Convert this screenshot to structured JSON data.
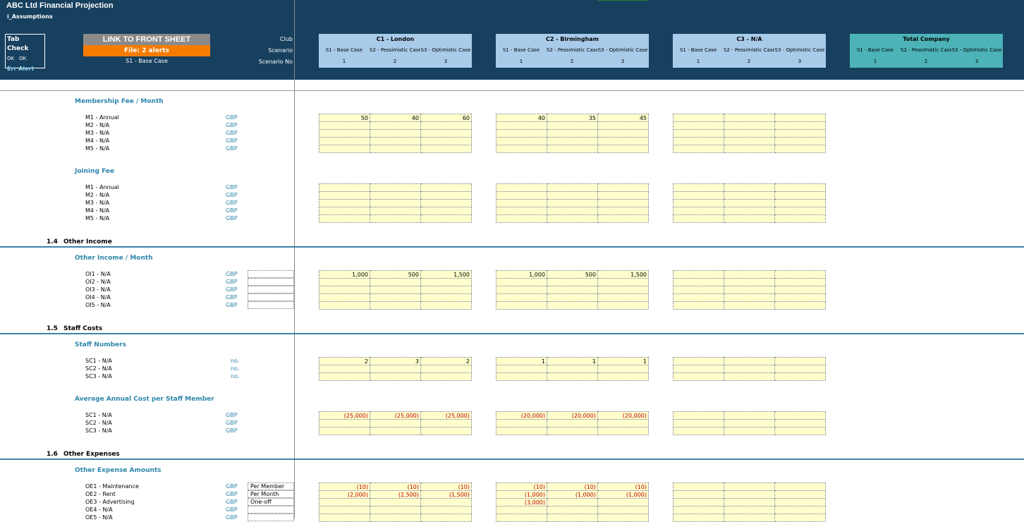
{
  "header": {
    "title": "ABC Ltd Financial Projection",
    "sheet": "i_Assumptions",
    "tab_check": {
      "title": "Tab Check",
      "ok1": "OK",
      "ok2": "OK",
      "err": "Err",
      "alert": "Alert"
    },
    "link_button": "LINK TO FRONT SHEET",
    "alerts_button": "File: 2 alerts",
    "selected_scenario": "S1 - Base Case",
    "labels": {
      "club": "Club",
      "scenario": "Scenario",
      "scenario_no": "Scenario No"
    },
    "clubs": [
      {
        "name": "C1 - London",
        "scenarios": [
          "S1 - Base Case",
          "S2 - Pessimistic Case",
          "S3 - Optimistic Case"
        ],
        "nums": [
          "1",
          "2",
          "3"
        ]
      },
      {
        "name": "C2 - Birmingham",
        "scenarios": [
          "S1 - Base Case",
          "S2 - Pessimistic Case",
          "S3 - Optimistic Case"
        ],
        "nums": [
          "1",
          "2",
          "3"
        ]
      },
      {
        "name": "C3 - N/A",
        "scenarios": [
          "S1 - Base Case",
          "S2 - Pessimistic Case",
          "S3 - Optimistic Case"
        ],
        "nums": [
          "1",
          "2",
          "3"
        ]
      },
      {
        "name": "Total Company",
        "scenarios": [
          "S1 - Base Case",
          "S2 - Pessimistic Case",
          "S3 - Optimistic Case"
        ],
        "nums": [
          "1",
          "2",
          "3"
        ]
      }
    ],
    "colors": {
      "header_bg": "#17405f",
      "club_bg": "#a9cbea",
      "total_bg": "#4db3b8",
      "alert_bg": "#f57c00",
      "input_bg": "#ffffcc"
    }
  },
  "sections": {
    "s14": {
      "num": "1.4",
      "title": "Other Income"
    },
    "s15": {
      "num": "1.5",
      "title": "Staff Costs"
    },
    "s16": {
      "num": "1.6",
      "title": "Other Expenses"
    }
  },
  "blocks": {
    "membership": {
      "title": "Membership Fee / Month",
      "rows": [
        "M1 - Annual",
        "M2 - N/A",
        "M3 - N/A",
        "M4 - N/A",
        "M5 - N/A"
      ],
      "unit": "GBP",
      "values": [
        [
          [
            "50",
            "40",
            "60"
          ],
          [
            "40",
            "35",
            "45"
          ],
          [
            "",
            "",
            ""
          ]
        ],
        [
          [
            "",
            "",
            ""
          ],
          [
            "",
            "",
            ""
          ],
          [
            "",
            "",
            ""
          ]
        ],
        [
          [
            "",
            "",
            ""
          ],
          [
            "",
            "",
            ""
          ],
          [
            "",
            "",
            ""
          ]
        ],
        [
          [
            "",
            "",
            ""
          ],
          [
            "",
            "",
            ""
          ],
          [
            "",
            "",
            ""
          ]
        ],
        [
          [
            "",
            "",
            ""
          ],
          [
            "",
            "",
            ""
          ],
          [
            "",
            "",
            ""
          ]
        ]
      ]
    },
    "joining": {
      "title": "Joining Fee",
      "rows": [
        "M1 - Annual",
        "M2 - N/A",
        "M3 - N/A",
        "M4 - N/A",
        "M5 - N/A"
      ],
      "unit": "GBP"
    },
    "other_income": {
      "title": "Other Income / Month",
      "rows": [
        "OI1 - N/A",
        "OI2 - N/A",
        "OI3 - N/A",
        "OI4 - N/A",
        "OI5 - N/A"
      ],
      "unit": "GBP",
      "values": [
        [
          [
            "1,000",
            "500",
            "1,500"
          ],
          [
            "1,000",
            "500",
            "1,500"
          ],
          [
            "",
            "",
            ""
          ]
        ]
      ]
    },
    "staff_numbers": {
      "title": "Staff Numbers",
      "rows": [
        "SC1 - N/A",
        "SC2 - N/A",
        "SC3 - N/A"
      ],
      "unit": "no.",
      "values": [
        [
          [
            "2",
            "3",
            "2"
          ],
          [
            "1",
            "1",
            "1"
          ],
          [
            "",
            "",
            ""
          ]
        ]
      ]
    },
    "staff_cost": {
      "title": "Average Annual Cost per Staff Member",
      "rows": [
        "SC1 - N/A",
        "SC2 - N/A",
        "SC3 - N/A"
      ],
      "unit": "GBP",
      "values": [
        [
          [
            "(25,000)",
            "(25,000)",
            "(25,000)"
          ],
          [
            "(20,000)",
            "(20,000)",
            "(20,000)"
          ],
          [
            "",
            "",
            ""
          ]
        ]
      ]
    },
    "other_expense": {
      "title": "Other Expense Amounts",
      "rows": [
        "OE1 - Maintenance",
        "OE2 - Rent",
        "OE3 - Advertising",
        "OE4 - N/A",
        "OE5 - N/A"
      ],
      "unit": "GBP",
      "extra": [
        "Per Member",
        "Per Month",
        "One-off",
        "",
        ""
      ],
      "values": [
        [
          [
            "(10)",
            "(10)",
            "(10)"
          ],
          [
            "(10)",
            "(10)",
            "(10)"
          ],
          [
            "",
            "",
            ""
          ]
        ],
        [
          [
            "(2,000)",
            "(2,500)",
            "(1,500)"
          ],
          [
            "(1,000)",
            "(1,000)",
            "(1,000)"
          ],
          [
            "",
            "",
            ""
          ]
        ],
        [
          [
            "",
            "",
            ""
          ],
          [
            "(3,000)",
            "",
            ""
          ],
          [
            "",
            "",
            ""
          ]
        ]
      ]
    }
  }
}
